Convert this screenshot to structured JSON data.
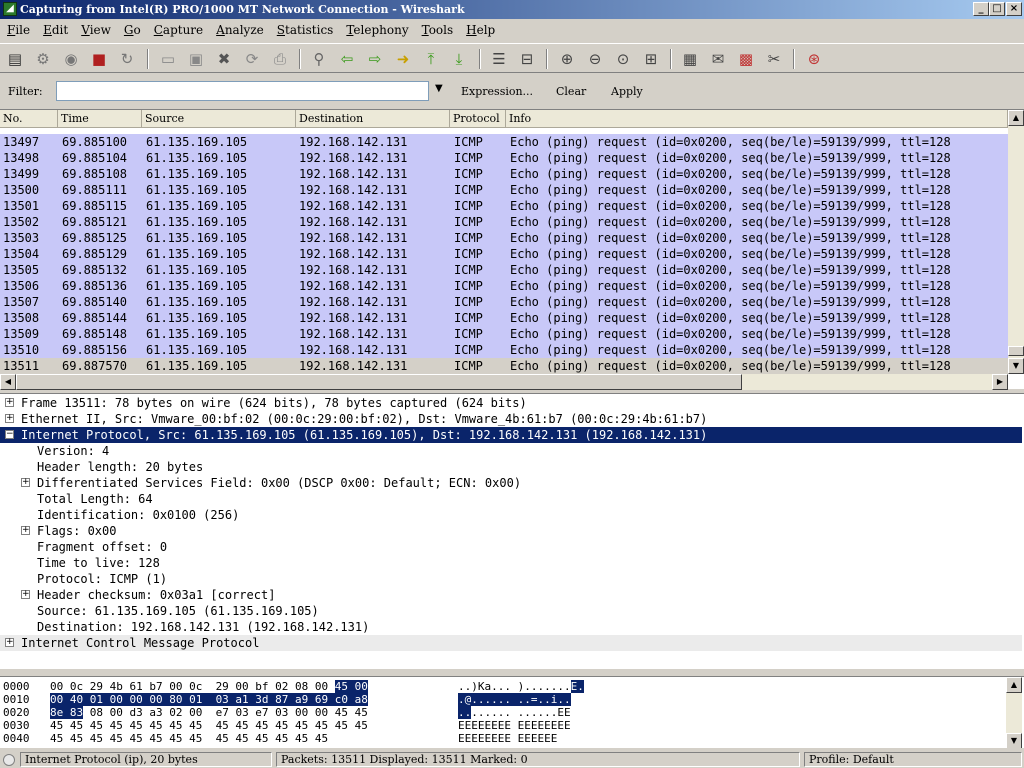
{
  "window": {
    "title": "Capturing from Intel(R) PRO/1000 MT Network Connection - Wireshark",
    "controls": [
      "_",
      "□",
      "×"
    ]
  },
  "menu": [
    "File",
    "Edit",
    "View",
    "Go",
    "Capture",
    "Analyze",
    "Statistics",
    "Telephony",
    "Tools",
    "Help"
  ],
  "filter": {
    "label": "Filter:",
    "value": "",
    "expression": "Expression...",
    "clear": "Clear",
    "apply": "Apply"
  },
  "packet_list": {
    "columns": [
      "No.",
      "Time",
      "Source",
      "Destination",
      "Protocol",
      "Info"
    ],
    "rows": [
      [
        "13497",
        "69.885100",
        "61.135.169.105",
        "192.168.142.131",
        "ICMP",
        "Echo (ping) request  (id=0x0200, seq(be/le)=59139/999, ttl=128"
      ],
      [
        "13498",
        "69.885104",
        "61.135.169.105",
        "192.168.142.131",
        "ICMP",
        "Echo (ping) request  (id=0x0200, seq(be/le)=59139/999, ttl=128"
      ],
      [
        "13499",
        "69.885108",
        "61.135.169.105",
        "192.168.142.131",
        "ICMP",
        "Echo (ping) request  (id=0x0200, seq(be/le)=59139/999, ttl=128"
      ],
      [
        "13500",
        "69.885111",
        "61.135.169.105",
        "192.168.142.131",
        "ICMP",
        "Echo (ping) request  (id=0x0200, seq(be/le)=59139/999, ttl=128"
      ],
      [
        "13501",
        "69.885115",
        "61.135.169.105",
        "192.168.142.131",
        "ICMP",
        "Echo (ping) request  (id=0x0200, seq(be/le)=59139/999, ttl=128"
      ],
      [
        "13502",
        "69.885121",
        "61.135.169.105",
        "192.168.142.131",
        "ICMP",
        "Echo (ping) request  (id=0x0200, seq(be/le)=59139/999, ttl=128"
      ],
      [
        "13503",
        "69.885125",
        "61.135.169.105",
        "192.168.142.131",
        "ICMP",
        "Echo (ping) request  (id=0x0200, seq(be/le)=59139/999, ttl=128"
      ],
      [
        "13504",
        "69.885129",
        "61.135.169.105",
        "192.168.142.131",
        "ICMP",
        "Echo (ping) request  (id=0x0200, seq(be/le)=59139/999, ttl=128"
      ],
      [
        "13505",
        "69.885132",
        "61.135.169.105",
        "192.168.142.131",
        "ICMP",
        "Echo (ping) request  (id=0x0200, seq(be/le)=59139/999, ttl=128"
      ],
      [
        "13506",
        "69.885136",
        "61.135.169.105",
        "192.168.142.131",
        "ICMP",
        "Echo (ping) request  (id=0x0200, seq(be/le)=59139/999, ttl=128"
      ],
      [
        "13507",
        "69.885140",
        "61.135.169.105",
        "192.168.142.131",
        "ICMP",
        "Echo (ping) request  (id=0x0200, seq(be/le)=59139/999, ttl=128"
      ],
      [
        "13508",
        "69.885144",
        "61.135.169.105",
        "192.168.142.131",
        "ICMP",
        "Echo (ping) request  (id=0x0200, seq(be/le)=59139/999, ttl=128"
      ],
      [
        "13509",
        "69.885148",
        "61.135.169.105",
        "192.168.142.131",
        "ICMP",
        "Echo (ping) request  (id=0x0200, seq(be/le)=59139/999, ttl=128"
      ],
      [
        "13510",
        "69.885156",
        "61.135.169.105",
        "192.168.142.131",
        "ICMP",
        "Echo (ping) request  (id=0x0200, seq(be/le)=59139/999, ttl=128"
      ],
      [
        "13511",
        "69.887570",
        "61.135.169.105",
        "192.168.142.131",
        "ICMP",
        "Echo (ping) request  (id=0x0200, seq(be/le)=59139/999, ttl=128"
      ]
    ],
    "selected_index": 14,
    "row_color": "#c8c8f8"
  },
  "details": [
    {
      "indent": 0,
      "expander": "+",
      "text": "Frame 13511: 78 bytes on wire (624 bits), 78 bytes captured (624 bits)"
    },
    {
      "indent": 0,
      "expander": "+",
      "text": "Ethernet II, Src: Vmware_00:bf:02 (00:0c:29:00:bf:02), Dst: Vmware_4b:61:b7 (00:0c:29:4b:61:b7)"
    },
    {
      "indent": 0,
      "expander": "−",
      "text": "Internet Protocol, Src: 61.135.169.105 (61.135.169.105), Dst: 192.168.142.131 (192.168.142.131)",
      "selected": true
    },
    {
      "indent": 1,
      "expander": "",
      "text": "Version: 4"
    },
    {
      "indent": 1,
      "expander": "",
      "text": "Header length: 20 bytes"
    },
    {
      "indent": 1,
      "expander": "+",
      "text": "Differentiated Services Field: 0x00 (DSCP 0x00: Default; ECN: 0x00)"
    },
    {
      "indent": 1,
      "expander": "",
      "text": "Total Length: 64"
    },
    {
      "indent": 1,
      "expander": "",
      "text": "Identification: 0x0100 (256)"
    },
    {
      "indent": 1,
      "expander": "+",
      "text": "Flags: 0x00"
    },
    {
      "indent": 1,
      "expander": "",
      "text": "Fragment offset: 0"
    },
    {
      "indent": 1,
      "expander": "",
      "text": "Time to live: 128"
    },
    {
      "indent": 1,
      "expander": "",
      "text": "Protocol: ICMP (1)"
    },
    {
      "indent": 1,
      "expander": "+",
      "text": "Header checksum: 0x03a1 [correct]"
    },
    {
      "indent": 1,
      "expander": "",
      "text": "Source: 61.135.169.105 (61.135.169.105)"
    },
    {
      "indent": 1,
      "expander": "",
      "text": "Destination: 192.168.142.131 (192.168.142.131)"
    },
    {
      "indent": 0,
      "expander": "+",
      "text": "Internet Control Message Protocol",
      "shaded": true
    }
  ],
  "bytes": [
    {
      "offset": "0000",
      "hex": [
        [
          "00 0c 29 4b 61 b7 00 0c  29 00 bf 02 08 00 ",
          ""
        ],
        [
          "45 00",
          "hl"
        ]
      ],
      "ascii": [
        [
          "..)Ka... ).......",
          ""
        ],
        [
          "E.",
          "hl"
        ]
      ]
    },
    {
      "offset": "0010",
      "hex": [
        [
          "00 40 01 00 00 00 80 01  03 a1 3d 87 a9 69 c0 a8",
          "hl"
        ]
      ],
      "ascii": [
        [
          ".@...... ..=..i..",
          "hl"
        ]
      ]
    },
    {
      "offset": "0020",
      "hex": [
        [
          "8e 83",
          "hl"
        ],
        [
          " 08 00 d3 a3 02 00  e7 03 e7 03 00 00 45 45",
          ""
        ]
      ],
      "ascii": [
        [
          "..",
          "hl"
        ],
        "...... ......EE"
      ]
    },
    {
      "offset": "0030",
      "hex": [
        [
          "45 45 45 45 45 45 45 45  45 45 45 45 45 45 45 45",
          ""
        ]
      ],
      "ascii": [
        [
          "EEEEEEEE EEEEEEEE",
          ""
        ]
      ]
    },
    {
      "offset": "0040",
      "hex": [
        [
          "45 45 45 45 45 45 45 45  45 45 45 45 45 45",
          ""
        ]
      ],
      "ascii": [
        [
          "EEEEEEEE EEEEEE",
          ""
        ]
      ]
    }
  ],
  "status": {
    "field": "Internet Protocol (ip), 20 bytes",
    "packets": "Packets: 13511 Displayed: 13511 Marked: 0",
    "profile": "Profile: Default"
  }
}
